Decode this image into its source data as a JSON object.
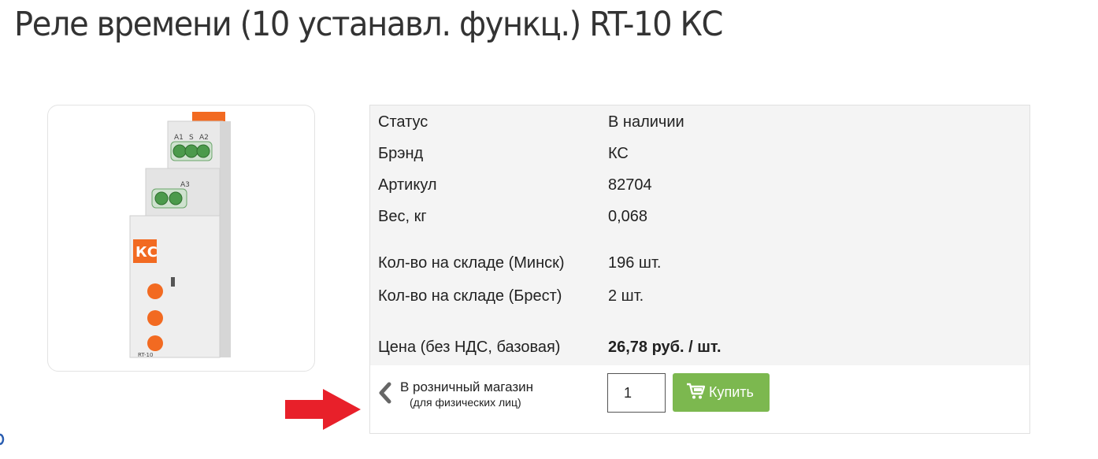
{
  "page": {
    "title": "Реле времени (10 устанавл. функц.) RT-10 КС"
  },
  "product_image": {
    "logo_text": "КС",
    "terminals_top": [
      "A1",
      "S",
      "A2"
    ],
    "terminal_bottom": "A3",
    "model_label": "RT-10"
  },
  "info": {
    "rows": [
      {
        "label": "Статус",
        "value": "В наличии"
      },
      {
        "label": "Брэнд",
        "value": "КС"
      },
      {
        "label": "Артикул",
        "value": "82704"
      },
      {
        "label": "Вес, кг",
        "value": "0,068"
      },
      {
        "label": "Кол-во на складе (Минск)",
        "value": "196 шт."
      },
      {
        "label": "Кол-во на складе (Брест)",
        "value": "2 шт."
      },
      {
        "label": "Цена (без НДС, базовая)",
        "value": "26,78 руб. / шт."
      }
    ]
  },
  "retail": {
    "main": "В розничный магазин",
    "sub": "(для физических лиц)",
    "icon": "chevron-left-icon"
  },
  "purchase": {
    "quantity": "1",
    "buy_label": "Купить",
    "icon": "cart-icon"
  },
  "colors": {
    "buy_green": "#7cb84f",
    "arrow_red": "#e8202a",
    "relay_orange": "#f26a21"
  }
}
